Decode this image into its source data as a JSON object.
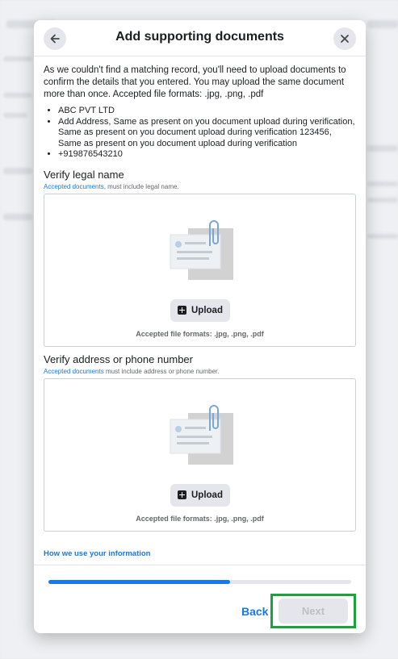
{
  "dialog": {
    "title": "Add supporting documents",
    "intro": "As we couldn't find a matching record, you'll need to upload documents to confirm the details that you entered. You may upload the same document more than once. Accepted file formats: .jpg, .png, .pdf",
    "details": [
      "ABC PVT LTD",
      "Add Address, Same as present on you document upload during verification, Same as present on you document upload during verification 123456, Same as present on you document upload during verification",
      "+919876543210"
    ],
    "sections": [
      {
        "title": "Verify legal name",
        "link": "Accepted documents,",
        "hint": " must include legal name.",
        "upload_label": "Upload",
        "formats": "Accepted file formats: .jpg, .png, .pdf"
      },
      {
        "title": "Verify address or phone number",
        "link": "Accepted documents",
        "hint": " must include address or phone number.",
        "upload_label": "Upload",
        "formats": "Accepted file formats: .jpg, .png, .pdf"
      }
    ],
    "info_link": "How we use your information",
    "progress_percent": 60,
    "back_label": "Back",
    "next_label": "Next",
    "next_enabled": false
  },
  "colors": {
    "accent": "#1877f2",
    "highlight_outline": "#1aa33a"
  },
  "icons": [
    "back-arrow-icon",
    "close-icon",
    "document-paperclip-icon",
    "plus-square-icon"
  ]
}
